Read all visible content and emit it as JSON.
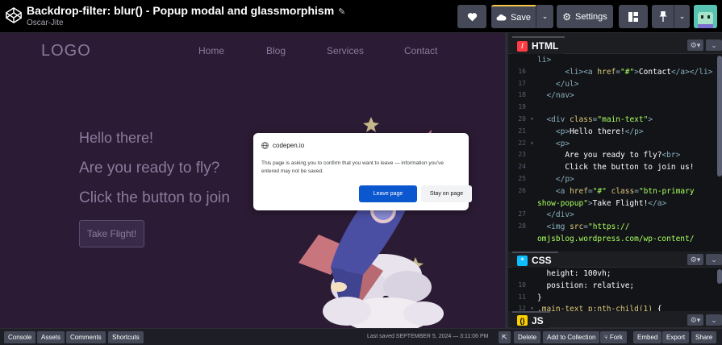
{
  "header": {
    "title": "Backdrop-filter: blur() - Popup modal and glassmorphism",
    "author": "Oscar-Jite",
    "save_label": "Save",
    "settings_label": "Settings"
  },
  "preview": {
    "logo": "LOGO",
    "nav": [
      "Home",
      "Blog",
      "Services",
      "Contact"
    ],
    "hero": [
      "Hello there!",
      "Are you ready to fly?",
      "Click the button to join"
    ],
    "cta": "Take Flight!"
  },
  "dialog": {
    "site": "codepen.io",
    "message": "This page is asking you to confirm that you want to leave — information you've entered may not be saved.",
    "leave": "Leave page",
    "stay": "Stay on page"
  },
  "panes": {
    "html": {
      "label": "HTML",
      "badge_color": "#ff3c41"
    },
    "css": {
      "label": "CSS",
      "badge_color": "#0ebeff"
    },
    "js": {
      "label": "JS",
      "badge_color": "#fcd000"
    }
  },
  "html_code": [
    {
      "ln": "",
      "fold": "",
      "parts": [
        [
          "tag",
          "li>"
        ]
      ]
    },
    {
      "ln": "16",
      "fold": "",
      "parts": [
        [
          "txt",
          "      "
        ],
        [
          "tag",
          "<li><a "
        ],
        [
          "attr",
          "href"
        ],
        [
          "tag",
          "="
        ],
        [
          "str",
          "\"#\""
        ],
        [
          "tag",
          ">"
        ],
        [
          "txt",
          "Contact"
        ],
        [
          "tag",
          "</a></li>"
        ]
      ]
    },
    {
      "ln": "17",
      "fold": "",
      "parts": [
        [
          "txt",
          "    "
        ],
        [
          "tag",
          "</ul>"
        ]
      ]
    },
    {
      "ln": "18",
      "fold": "",
      "parts": [
        [
          "txt",
          "  "
        ],
        [
          "tag",
          "</nav>"
        ]
      ]
    },
    {
      "ln": "19",
      "fold": "",
      "parts": []
    },
    {
      "ln": "20",
      "fold": "▾",
      "parts": [
        [
          "txt",
          "  "
        ],
        [
          "tag",
          "<div "
        ],
        [
          "attr",
          "class"
        ],
        [
          "tag",
          "="
        ],
        [
          "str",
          "\"main-text\""
        ],
        [
          "tag",
          ">"
        ]
      ]
    },
    {
      "ln": "21",
      "fold": "",
      "parts": [
        [
          "txt",
          "    "
        ],
        [
          "tag",
          "<p>"
        ],
        [
          "txt",
          "Hello there!"
        ],
        [
          "tag",
          "</p>"
        ]
      ]
    },
    {
      "ln": "22",
      "fold": "▾",
      "parts": [
        [
          "txt",
          "    "
        ],
        [
          "tag",
          "<p>"
        ]
      ]
    },
    {
      "ln": "23",
      "fold": "",
      "parts": [
        [
          "txt",
          "      Are you ready to fly?"
        ],
        [
          "tag",
          "<br>"
        ]
      ]
    },
    {
      "ln": "24",
      "fold": "",
      "parts": [
        [
          "txt",
          "      Click the button to join us!"
        ]
      ]
    },
    {
      "ln": "25",
      "fold": "",
      "parts": [
        [
          "txt",
          "    "
        ],
        [
          "tag",
          "</p>"
        ]
      ]
    },
    {
      "ln": "26",
      "fold": "",
      "parts": [
        [
          "txt",
          "    "
        ],
        [
          "tag",
          "<a "
        ],
        [
          "attr",
          "href"
        ],
        [
          "tag",
          "="
        ],
        [
          "str",
          "\"#\""
        ],
        [
          "txt",
          " "
        ],
        [
          "attr",
          "class"
        ],
        [
          "tag",
          "="
        ],
        [
          "str",
          "\"btn-primary"
        ]
      ]
    },
    {
      "ln": "",
      "fold": "",
      "parts": [
        [
          "str",
          "show-popup\""
        ],
        [
          "tag",
          ">"
        ],
        [
          "txt",
          "Take Flight!"
        ],
        [
          "tag",
          "</a>"
        ]
      ]
    },
    {
      "ln": "27",
      "fold": "",
      "parts": [
        [
          "txt",
          "  "
        ],
        [
          "tag",
          "</div>"
        ]
      ]
    },
    {
      "ln": "28",
      "fold": "",
      "parts": [
        [
          "txt",
          "  "
        ],
        [
          "tag",
          "<img "
        ],
        [
          "attr",
          "src"
        ],
        [
          "tag",
          "="
        ],
        [
          "str",
          "\"https://"
        ]
      ]
    },
    {
      "ln": "",
      "fold": "",
      "parts": [
        [
          "str",
          "omjsblog.wordpress.com/wp-content/"
        ]
      ]
    }
  ],
  "css_code": [
    {
      "ln": "",
      "fold": "",
      "parts": [
        [
          "prop",
          "  height: 100vh;"
        ]
      ]
    },
    {
      "ln": "10",
      "fold": "",
      "parts": [
        [
          "prop",
          "  position"
        ],
        [
          "txt",
          ": "
        ],
        [
          "val",
          "relative;"
        ]
      ]
    },
    {
      "ln": "11",
      "fold": "",
      "parts": [
        [
          "txt",
          "}"
        ]
      ]
    },
    {
      "ln": "12",
      "fold": "▾",
      "parts": [
        [
          "sel",
          ".main-text p:nth-child(1)"
        ],
        [
          "txt",
          " {"
        ]
      ]
    }
  ],
  "footer": {
    "left": [
      "Console",
      "Assets",
      "Comments",
      "Shortcuts"
    ],
    "last_saved": "Last saved SEPTEMBER 5, 2024 — 3:11:06 PM",
    "right": [
      "Delete",
      "Add to Collection",
      "Fork",
      "Embed",
      "Export",
      "Share"
    ]
  }
}
